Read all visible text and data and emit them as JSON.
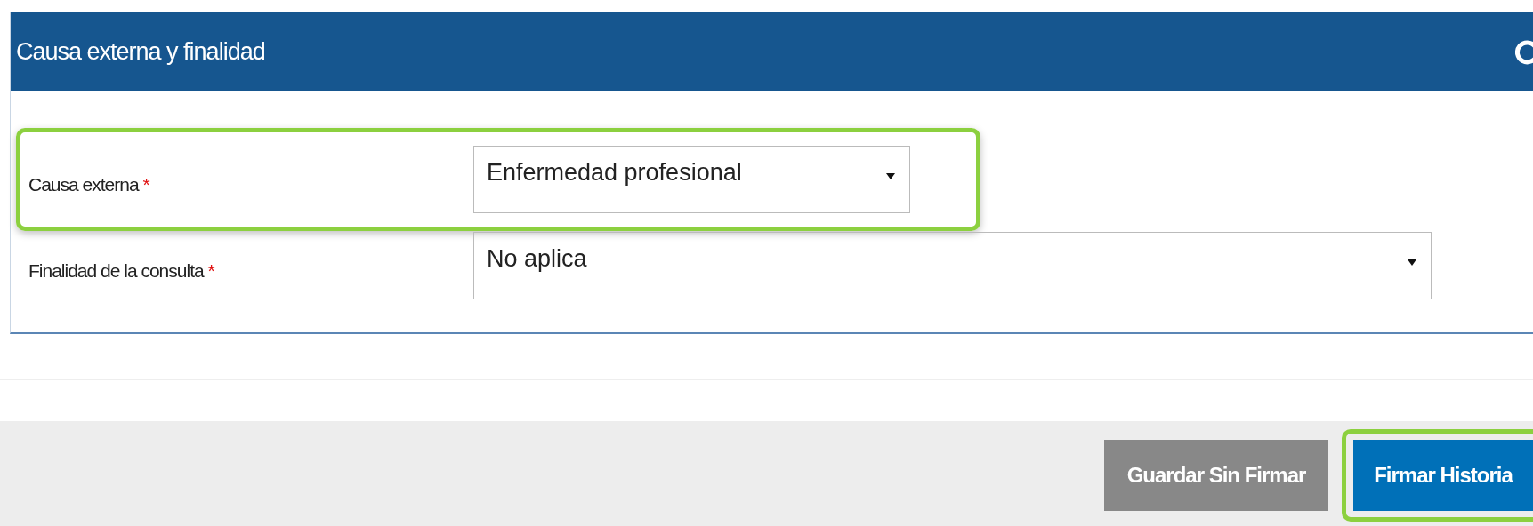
{
  "panel": {
    "title": "Causa externa y finalidad"
  },
  "fields": [
    {
      "label": "Causa externa",
      "required_mark": "*",
      "value": "Enfermedad profesional",
      "highlighted": true,
      "wide": false
    },
    {
      "label": "Finalidad de la consulta",
      "required_mark": "*",
      "value": "No aplica",
      "highlighted": false,
      "wide": true
    }
  ],
  "buttons": [
    {
      "label": "Guardar Sin Firmar",
      "kind": "secondary",
      "highlighted": false
    },
    {
      "label": "Firmar Historia",
      "kind": "primary",
      "highlighted": true
    }
  ]
}
